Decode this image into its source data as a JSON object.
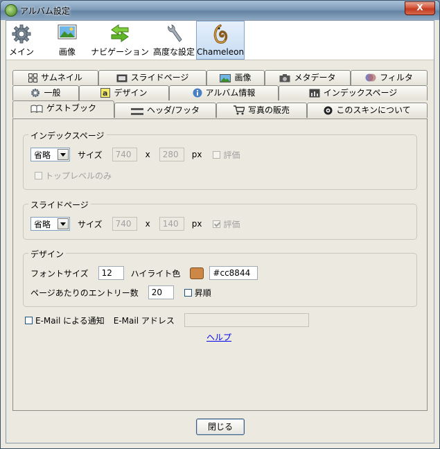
{
  "window": {
    "title": "アルバム設定",
    "close_label": "X"
  },
  "toolbar": {
    "items": [
      {
        "label": "メイン",
        "icon": "gear-icon"
      },
      {
        "label": "画像",
        "icon": "image-icon"
      },
      {
        "label": "ナビゲーション",
        "icon": "arrows-icon"
      },
      {
        "label": "高度な設定",
        "icon": "wrench-icon"
      },
      {
        "label": "Chameleon",
        "icon": "chameleon-icon",
        "active": true
      }
    ]
  },
  "tabs": {
    "row1": [
      "サムネイル",
      "スライドページ",
      "画像",
      "メタデータ",
      "フィルタ"
    ],
    "row2": [
      "一般",
      "デザイン",
      "アルバム情報",
      "インデックスページ"
    ],
    "row3": [
      "ゲストブック",
      "ヘッダ/フッタ",
      "写真の販売",
      "このスキンについて"
    ],
    "selected": "ゲストブック"
  },
  "index_group": {
    "title": "インデックスページ",
    "combo_value": "省略",
    "size_label": "サイズ",
    "width": "740",
    "x_label": "x",
    "height": "280",
    "unit": "px",
    "rating_label": "評価",
    "rating_checked": false,
    "toplevel_label": "トップレベルのみ"
  },
  "slide_group": {
    "title": "スライドページ",
    "combo_value": "省略",
    "size_label": "サイズ",
    "width": "740",
    "x_label": "x",
    "height": "140",
    "unit": "px",
    "rating_label": "評価",
    "rating_checked": true
  },
  "design_group": {
    "title": "デザイン",
    "font_size_label": "フォントサイズ",
    "font_size": "12",
    "highlight_label": "ハイライト色",
    "highlight_color": "#cc8844",
    "entries_label": "ページあたりのエントリー数",
    "entries": "20",
    "ascending_label": "昇順"
  },
  "email": {
    "notify_label": "E-Mail による通知",
    "address_label": "E-Mail アドレス",
    "address_value": ""
  },
  "help_link": "ヘルプ",
  "close_button": "閉じる"
}
